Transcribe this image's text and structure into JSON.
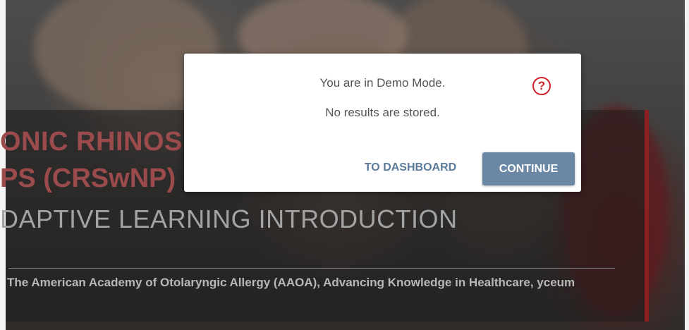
{
  "hero": {
    "title_line1": "ONIC RHINOS",
    "title_line2": "PS (CRSwNP)",
    "subtitle": "DAPTIVE LEARNING INTRODUCTION",
    "credits": "The American Academy of Otolaryngic Allergy (AAOA), Advancing Knowledge in Healthcare, yceum"
  },
  "modal": {
    "message_line1": "You are in Demo Mode.",
    "message_line2": "No results are stored.",
    "help_icon_glyph": "?",
    "dashboard_label": "TO DASHBOARD",
    "continue_label": "CONTINUE"
  },
  "colors": {
    "accent_red": "#d0222a",
    "button_blue": "#6a87a6",
    "link_blue": "#5c7a99",
    "panel_border": "#8c1f22"
  }
}
